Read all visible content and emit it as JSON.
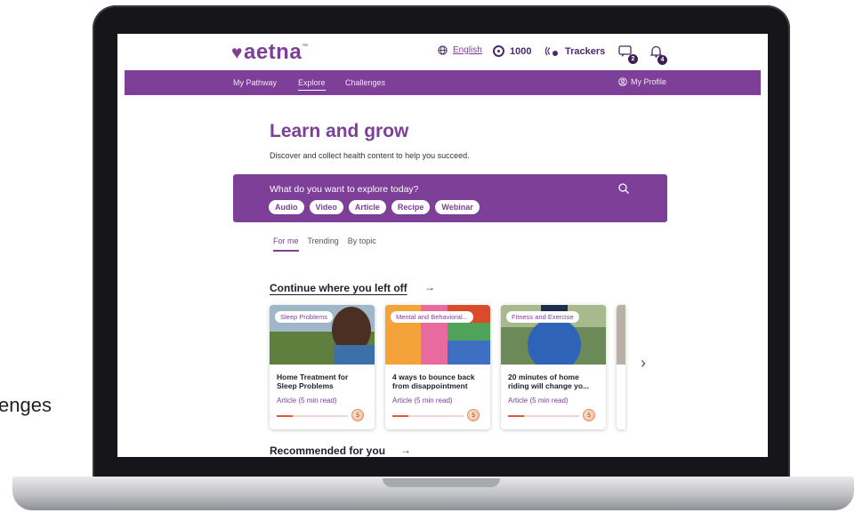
{
  "background_caption": "enges",
  "header": {
    "logo": "aetna",
    "logo_tm": "™",
    "language": "English",
    "points": "1000",
    "trackers": "Trackers",
    "messages_count": "2",
    "notifications_count": "4"
  },
  "nav": {
    "items": [
      "My Pathway",
      "Explore",
      "Challenges"
    ],
    "active": "Explore",
    "profile": "My Profile"
  },
  "main": {
    "title": "Learn and grow",
    "subtitle": "Discover and collect health content to help you succeed.",
    "search": {
      "question": "What do you want to explore today?",
      "chips": [
        "Audio",
        "Video",
        "Article",
        "Recipe",
        "Webinar"
      ]
    },
    "tabs": [
      "For me",
      "Trending",
      "By topic"
    ],
    "active_tab": "For me",
    "continue_title": "Continue where you left off",
    "recommended_title": "Recommended for you",
    "cards": [
      {
        "tag": "Sleep Problems",
        "title": "Home Treatment for Sleep Problems",
        "meta": "Article (5 min read)",
        "points": "5",
        "progress": 0.22
      },
      {
        "tag": "Mental and Behavioral...",
        "title": "4 ways to bounce back from disappointment",
        "meta": "Article (5 min read)",
        "points": "5",
        "progress": 0.22
      },
      {
        "tag": "Fitness and Exercise",
        "title": "20 minutes of home riding will change yo...",
        "meta": "Article (5 min read)",
        "points": "5",
        "progress": 0.22
      }
    ]
  },
  "colors": {
    "brand": "#7d3f98",
    "progress": "#e2573a"
  }
}
